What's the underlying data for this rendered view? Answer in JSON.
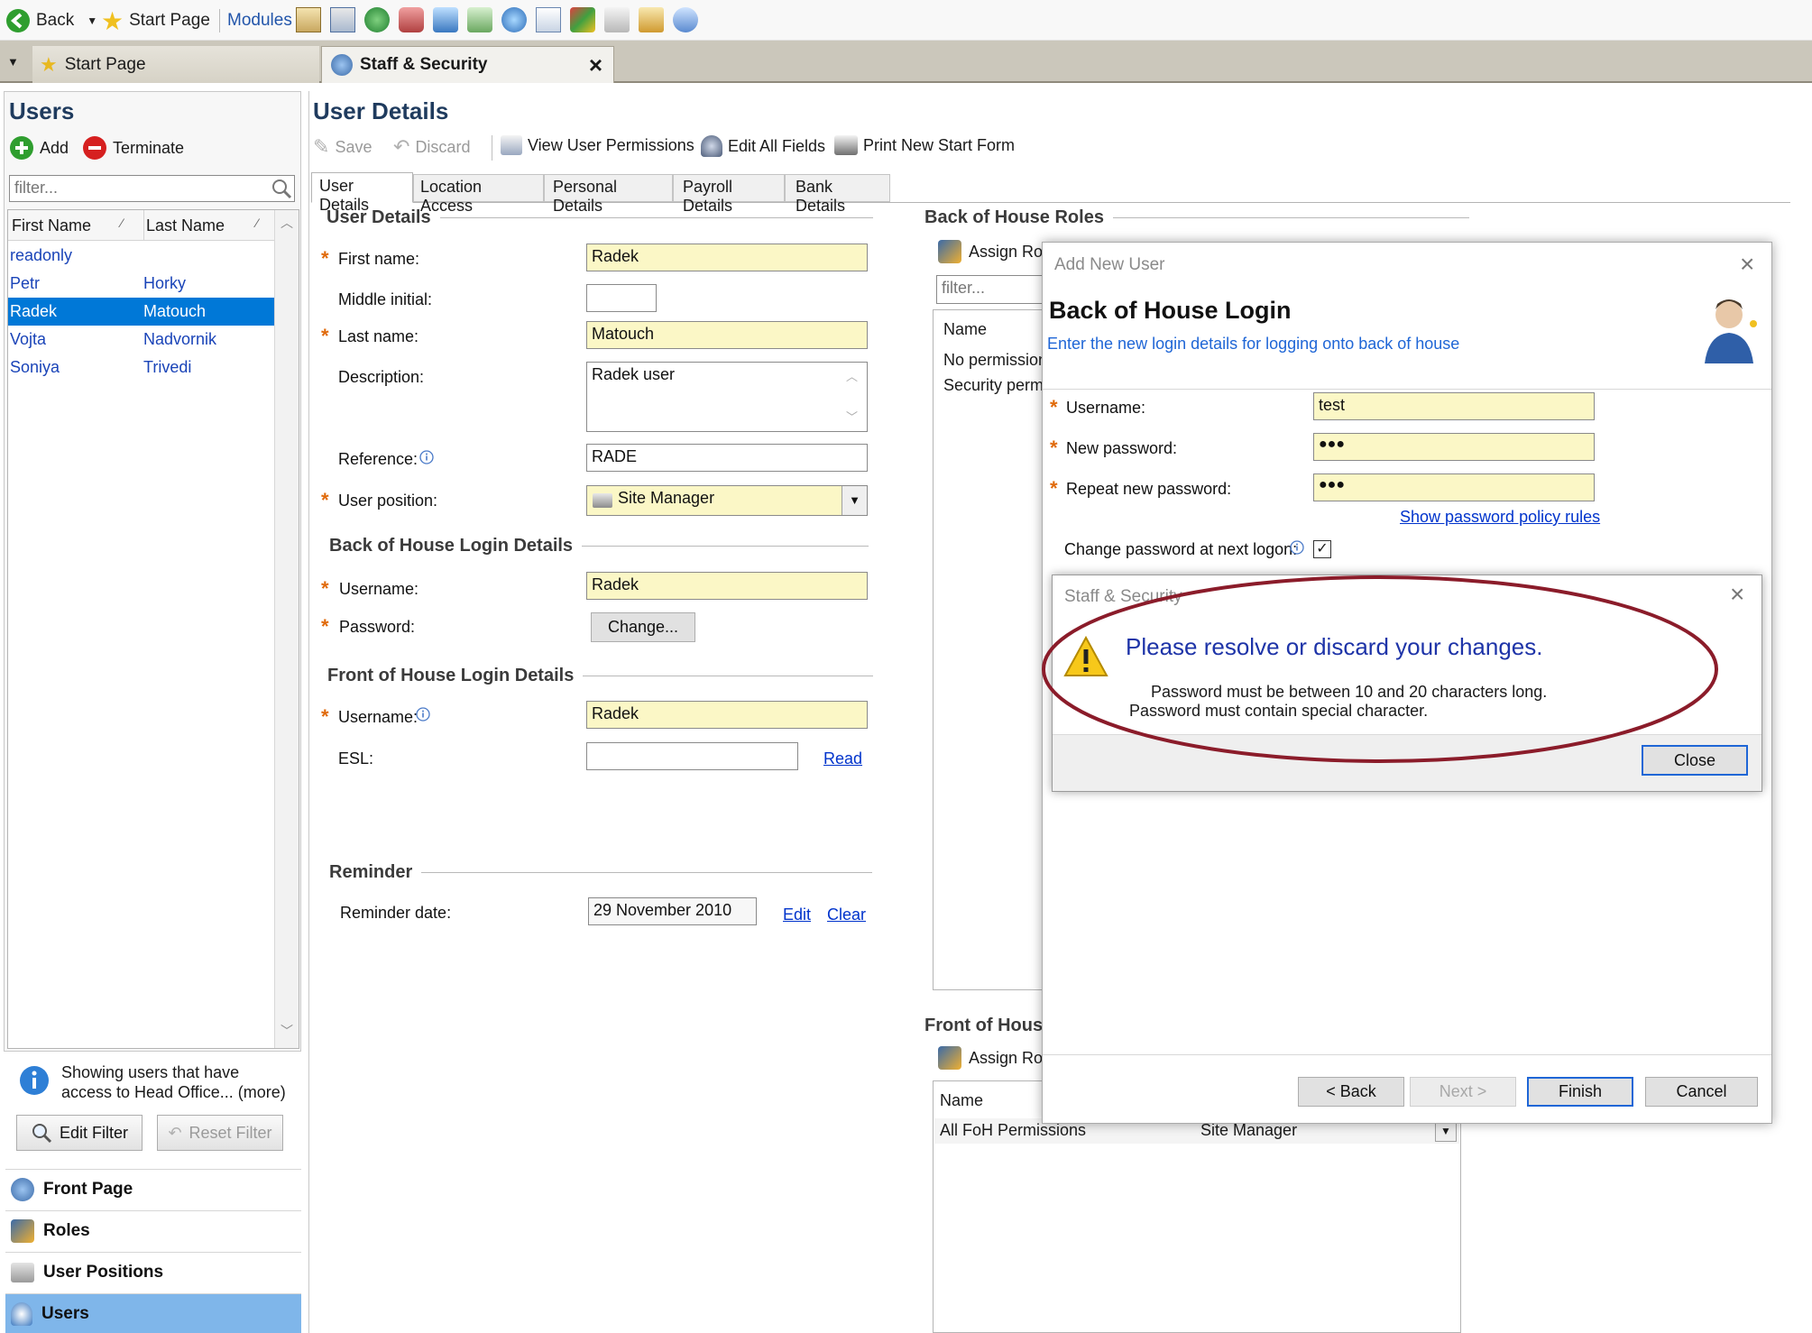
{
  "toolbar": {
    "back_label": "Back",
    "start_page_label": "Start Page",
    "modules_label": "Modules"
  },
  "tabs": {
    "start_page": "Start Page",
    "staff_security": "Staff & Security",
    "close_glyph": "×"
  },
  "users_panel": {
    "title": "Users",
    "add_label": "Add",
    "terminate_label": "Terminate",
    "filter_placeholder": "filter...",
    "col_first": "First Name",
    "col_last": "Last Name",
    "rows": [
      {
        "first": "readonly",
        "last": ""
      },
      {
        "first": "Petr",
        "last": "Horky"
      },
      {
        "first": "Radek",
        "last": "Matouch"
      },
      {
        "first": "Vojta",
        "last": "Nadvornik"
      },
      {
        "first": "Soniya",
        "last": "Trivedi"
      }
    ],
    "info_line1": "Showing users that have",
    "info_line2": "access to Head Office... (more)",
    "edit_filter": "Edit Filter",
    "reset_filter": "Reset Filter"
  },
  "nav": {
    "front_page": "Front Page",
    "roles": "Roles",
    "user_positions": "User Positions",
    "users": "Users"
  },
  "details": {
    "title": "User Details",
    "actions": {
      "save": "Save",
      "discard": "Discard",
      "view_permissions": "View User Permissions",
      "edit_all": "Edit All Fields",
      "print_form": "Print New Start Form"
    },
    "tabs": [
      "User Details",
      "Location Access",
      "Personal Details",
      "Payroll Details",
      "Bank Details"
    ],
    "section_user": "User Details",
    "first_name_label": "First name:",
    "first_name": "Radek",
    "middle_label": "Middle initial:",
    "middle": "",
    "last_name_label": "Last name:",
    "last_name": "Matouch",
    "description_label": "Description:",
    "description": "Radek user",
    "reference_label": "Reference:",
    "reference": "RADE",
    "position_label": "User position:",
    "position": "Site Manager",
    "section_boh": "Back of House Login Details",
    "boh_username_label": "Username:",
    "boh_username": "Radek",
    "password_label": "Password:",
    "change_btn": "Change...",
    "section_foh": "Front of House Login Details",
    "foh_username_label": "Username:",
    "foh_username": "Radek",
    "esl_label": "ESL:",
    "esl": "",
    "read_link": "Read",
    "section_reminder": "Reminder",
    "reminder_label": "Reminder date:",
    "reminder_date": "29 November 2010",
    "edit_link": "Edit",
    "clear_link": "Clear"
  },
  "roles": {
    "boh_title": "Back of House Roles",
    "assign_label": "Assign Rol",
    "filter_placeholder": "filter...",
    "col_name": "Name",
    "boh_row1": "No permission",
    "boh_row2": "Security permi",
    "foh_title": "Front of House",
    "foh_assign": "Assign Rol",
    "foh_col_name": "Name",
    "foh_row_name": "All FoH Permissions",
    "foh_row_position": "Site Manager"
  },
  "wizard": {
    "window_title": "Add New User",
    "heading": "Back of House Login",
    "subtitle": "Enter the new login details for logging onto back of house",
    "username_label": "Username:",
    "username": "test",
    "new_password_label": "New password:",
    "new_password": "●●●",
    "repeat_label": "Repeat new password:",
    "repeat_password": "●●●",
    "policy_link": "Show password policy rules",
    "change_next_label": "Change password at next logon:",
    "change_next_checked": true,
    "back_btn": "< Back",
    "next_btn": "Next >",
    "finish_btn": "Finish",
    "cancel_btn": "Cancel"
  },
  "message": {
    "title": "Staff & Security",
    "heading": "Please resolve or discard your changes.",
    "line1": "Password must be between 10 and 20 characters long.",
    "line2": "Password must contain special character.",
    "close_btn": "Close"
  },
  "colors": {
    "selection": "#0078d7",
    "required_bg": "#fbf7c6",
    "link": "#0033cc",
    "panel_title": "#1f3b5e",
    "annotation": "#8b1c2a",
    "required_star": "#e06a0a"
  }
}
